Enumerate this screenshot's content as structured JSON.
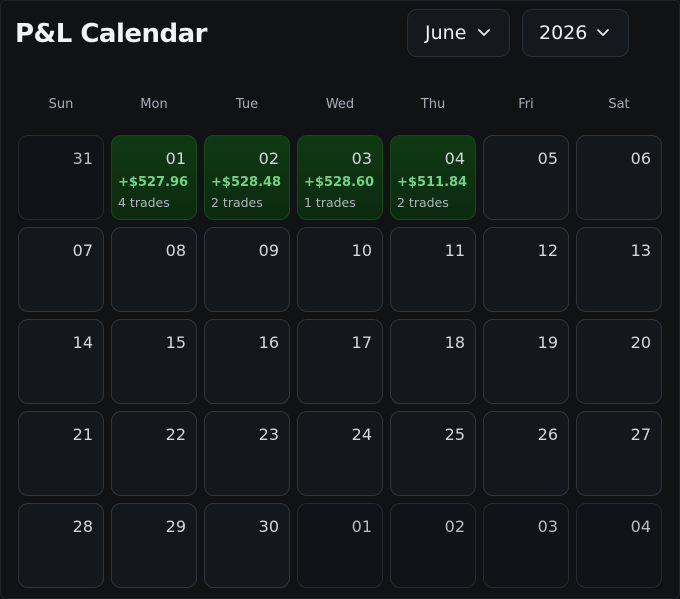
{
  "header": {
    "title": "P&L Calendar",
    "month": "June",
    "year": "2026"
  },
  "weekdays": [
    "Sun",
    "Mon",
    "Tue",
    "Wed",
    "Thu",
    "Fri",
    "Sat"
  ],
  "accent_profit_color": "#6fd38a",
  "weeks": [
    [
      {
        "day": "31",
        "outside": true
      },
      {
        "day": "01",
        "pnl": "+$527.96",
        "trades": "4 trades"
      },
      {
        "day": "02",
        "pnl": "+$528.48",
        "trades": "2 trades"
      },
      {
        "day": "03",
        "pnl": "+$528.60",
        "trades": "1 trades"
      },
      {
        "day": "04",
        "pnl": "+$511.84",
        "trades": "2 trades"
      },
      {
        "day": "05"
      },
      {
        "day": "06"
      }
    ],
    [
      {
        "day": "07"
      },
      {
        "day": "08"
      },
      {
        "day": "09"
      },
      {
        "day": "10"
      },
      {
        "day": "11"
      },
      {
        "day": "12"
      },
      {
        "day": "13"
      }
    ],
    [
      {
        "day": "14"
      },
      {
        "day": "15"
      },
      {
        "day": "16"
      },
      {
        "day": "17"
      },
      {
        "day": "18"
      },
      {
        "day": "19"
      },
      {
        "day": "20"
      }
    ],
    [
      {
        "day": "21"
      },
      {
        "day": "22"
      },
      {
        "day": "23"
      },
      {
        "day": "24"
      },
      {
        "day": "25"
      },
      {
        "day": "26"
      },
      {
        "day": "27"
      }
    ],
    [
      {
        "day": "28"
      },
      {
        "day": "29"
      },
      {
        "day": "30"
      },
      {
        "day": "01",
        "outside": true
      },
      {
        "day": "02",
        "outside": true
      },
      {
        "day": "03",
        "outside": true
      },
      {
        "day": "04",
        "outside": true
      }
    ]
  ]
}
